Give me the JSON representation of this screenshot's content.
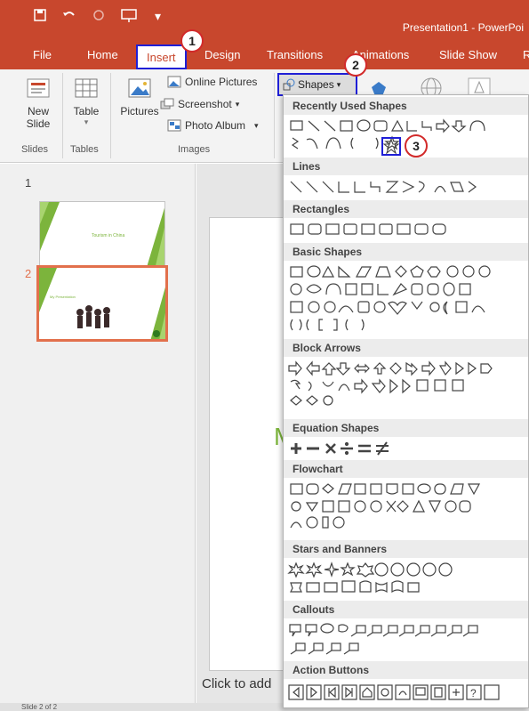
{
  "titlebar": {
    "qat_icons": [
      "save-icon",
      "undo-icon",
      "redo-icon",
      "present-icon",
      "more-icon"
    ],
    "title": "Presentation1 - PowerPoi"
  },
  "tabs": [
    "File",
    "Home",
    "Insert",
    "Design",
    "Transitions",
    "Animations",
    "Slide Show",
    "R"
  ],
  "ribbon": {
    "new_slide": "New\nSlide",
    "table": "Table",
    "pictures": "Pictures",
    "online_pictures": "Online Pictures",
    "screenshot": "Screenshot",
    "photo_album": "Photo Album",
    "shapes": "Shapes",
    "groups": {
      "slides": "Slides",
      "tables": "Tables",
      "images": "Images"
    }
  },
  "thumbnails": [
    {
      "number": "1",
      "caption": "Tourism in China"
    },
    {
      "number": "2",
      "caption": "My Presentation"
    }
  ],
  "slide": {
    "title_fragment": "My",
    "notes_placeholder": "Click to add"
  },
  "status": {
    "text": "Slide 2 of 2"
  },
  "shapes_menu": {
    "sections": [
      "Recently Used Shapes",
      "Lines",
      "Rectangles",
      "Basic Shapes",
      "Block Arrows",
      "Equation Shapes",
      "Flowchart",
      "Stars and Banners",
      "Callouts",
      "Action Buttons"
    ]
  },
  "steps": [
    "1",
    "2",
    "3"
  ],
  "colors": {
    "accent": "#c8472d",
    "highlight": "#1f1fd6",
    "step_ring": "#d22a2a",
    "slide_green": "#7cb43c",
    "thumb_selected": "#e2704c"
  }
}
